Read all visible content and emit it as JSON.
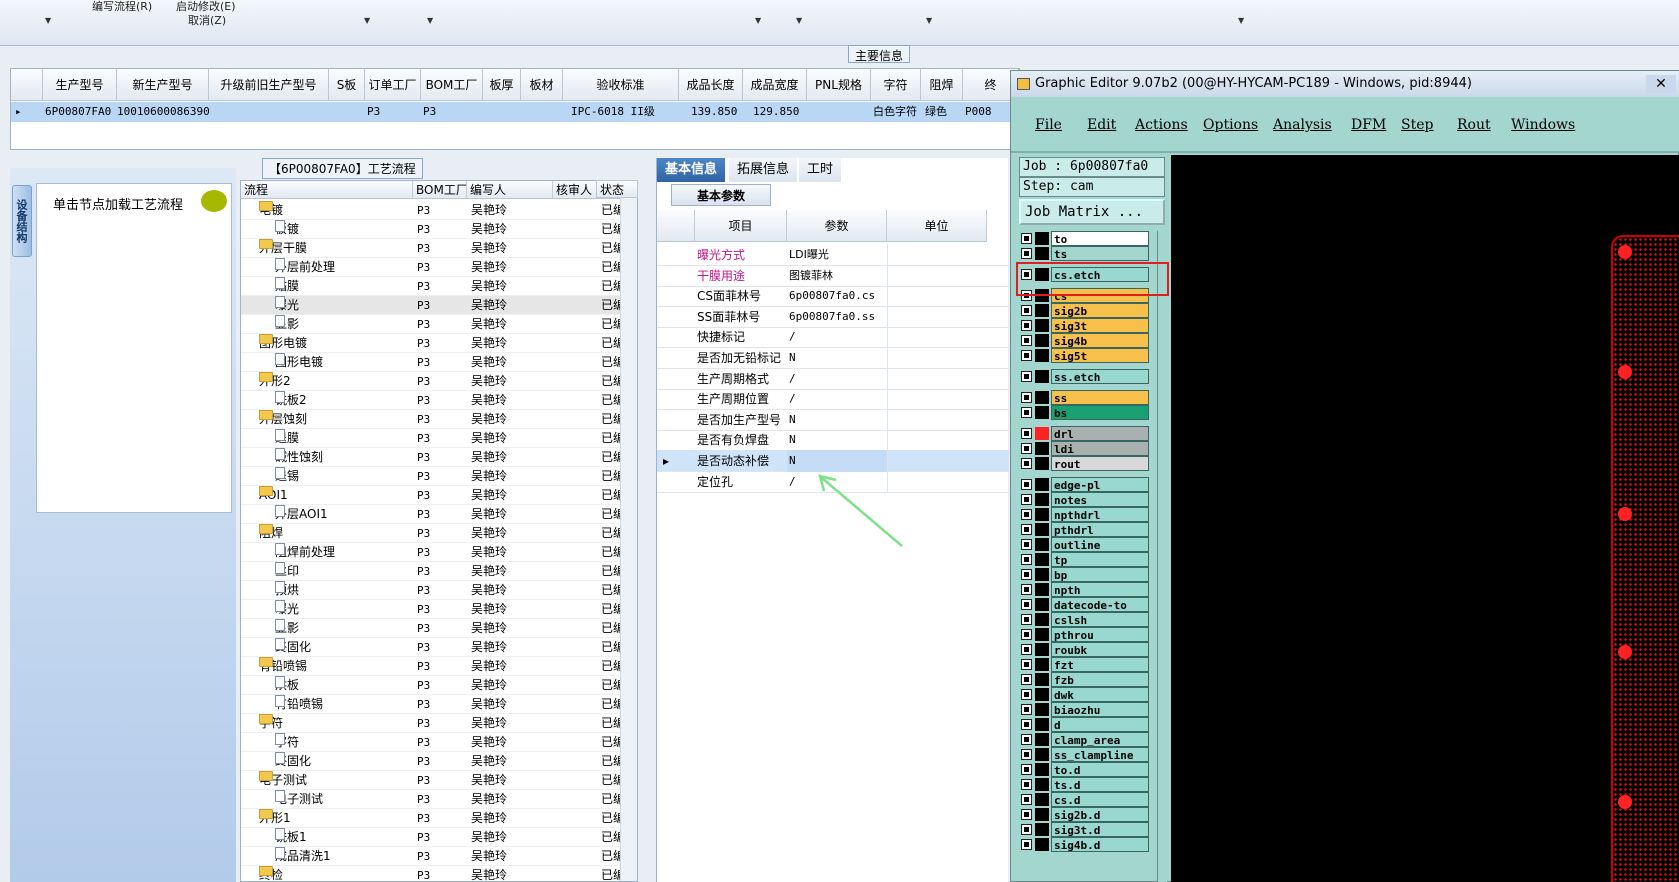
{
  "toolbar": {
    "item1": "编写流程(R)",
    "item2": "启动修改(E)",
    "item3": "取消(Z)"
  },
  "main_info_label": "主要信息",
  "product_table": {
    "columns": [
      "生产型号",
      "新生产型号",
      "升级前旧生产型号",
      "S板",
      "订单工厂",
      "BOM工厂",
      "板厚",
      "板材",
      "验收标准",
      "成品长度",
      "成品宽度",
      "PNL规格",
      "字符",
      "阻焊",
      "终"
    ],
    "row": [
      "6P00807FA0",
      "10010600086390",
      "",
      "",
      "P3",
      "P3",
      "",
      "",
      "IPC-6018 II级",
      "139.850",
      "129.850",
      "",
      "白色字符",
      "绿色",
      "P008"
    ]
  },
  "left_panel": {
    "tab_label": "设备结构",
    "hint": "单击节点加载工艺流程"
  },
  "process": {
    "title": "【6P00807FA0】工艺流程",
    "columns": [
      "流程",
      "BOM工厂",
      "编写人",
      "核审人",
      "状态"
    ],
    "rows": [
      {
        "name": "电镀",
        "type": "folder",
        "factory": "P3",
        "writer": "吴艳玲",
        "status": "已编写"
      },
      {
        "name": "板镀",
        "type": "doc",
        "factory": "P3",
        "writer": "吴艳玲",
        "status": "已编写"
      },
      {
        "name": "外层干膜",
        "type": "folder",
        "factory": "P3",
        "writer": "吴艳玲",
        "status": "已编写"
      },
      {
        "name": "外层前处理",
        "type": "doc",
        "factory": "P3",
        "writer": "吴艳玲",
        "status": "已编写"
      },
      {
        "name": "贴膜",
        "type": "doc",
        "factory": "P3",
        "writer": "吴艳玲",
        "status": "已编写"
      },
      {
        "name": "曝光",
        "type": "doc",
        "factory": "P3",
        "writer": "吴艳玲",
        "status": "已编写",
        "selected": true
      },
      {
        "name": "显影",
        "type": "doc",
        "factory": "P3",
        "writer": "吴艳玲",
        "status": "已编写"
      },
      {
        "name": "图形电镀",
        "type": "folder",
        "factory": "P3",
        "writer": "吴艳玲",
        "status": "已编写"
      },
      {
        "name": "图形电镀",
        "type": "doc",
        "factory": "P3",
        "writer": "吴艳玲",
        "status": "已编写"
      },
      {
        "name": "外形2",
        "type": "folder",
        "factory": "P3",
        "writer": "吴艳玲",
        "status": "已编写"
      },
      {
        "name": "铣板2",
        "type": "doc",
        "factory": "P3",
        "writer": "吴艳玲",
        "status": "已编写"
      },
      {
        "name": "外层蚀刻",
        "type": "folder",
        "factory": "P3",
        "writer": "吴艳玲",
        "status": "已编写"
      },
      {
        "name": "退膜",
        "type": "doc",
        "factory": "P3",
        "writer": "吴艳玲",
        "status": "已编写"
      },
      {
        "name": "碱性蚀刻",
        "type": "doc",
        "factory": "P3",
        "writer": "吴艳玲",
        "status": "已编写"
      },
      {
        "name": "退锡",
        "type": "doc",
        "factory": "P3",
        "writer": "吴艳玲",
        "status": "已编写"
      },
      {
        "name": "AOI1",
        "type": "folder",
        "factory": "P3",
        "writer": "吴艳玲",
        "status": "已编写"
      },
      {
        "name": "外层AOI1",
        "type": "doc",
        "factory": "P3",
        "writer": "吴艳玲",
        "status": "已编写"
      },
      {
        "name": "阻焊",
        "type": "folder",
        "factory": "P3",
        "writer": "吴艳玲",
        "status": "已编写"
      },
      {
        "name": "阻焊前处理",
        "type": "doc",
        "factory": "P3",
        "writer": "吴艳玲",
        "status": "已编写"
      },
      {
        "name": "丝印",
        "type": "doc",
        "factory": "P3",
        "writer": "吴艳玲",
        "status": "已编写"
      },
      {
        "name": "预烘",
        "type": "doc",
        "factory": "P3",
        "writer": "吴艳玲",
        "status": "已编写"
      },
      {
        "name": "曝光",
        "type": "doc",
        "factory": "P3",
        "writer": "吴艳玲",
        "status": "已编写"
      },
      {
        "name": "显影",
        "type": "doc",
        "factory": "P3",
        "writer": "吴艳玲",
        "status": "已编写"
      },
      {
        "name": "终固化",
        "type": "doc",
        "factory": "P3",
        "writer": "吴艳玲",
        "status": "已编写"
      },
      {
        "name": "有铅喷锡",
        "type": "folder",
        "factory": "P3",
        "writer": "吴艳玲",
        "status": "已编写"
      },
      {
        "name": "烘板",
        "type": "doc",
        "factory": "P3",
        "writer": "吴艳玲",
        "status": "已编写"
      },
      {
        "name": "有铅喷锡",
        "type": "doc",
        "factory": "P3",
        "writer": "吴艳玲",
        "status": "已编写"
      },
      {
        "name": "字符",
        "type": "folder",
        "factory": "P3",
        "writer": "吴艳玲",
        "status": "已编写"
      },
      {
        "name": "字符",
        "type": "doc",
        "factory": "P3",
        "writer": "吴艳玲",
        "status": "已编写"
      },
      {
        "name": "终固化",
        "type": "doc",
        "factory": "P3",
        "writer": "吴艳玲",
        "status": "已编写"
      },
      {
        "name": "电子测试",
        "type": "folder",
        "factory": "P3",
        "writer": "吴艳玲",
        "status": "已编写"
      },
      {
        "name": "电子测试",
        "type": "doc",
        "factory": "P3",
        "writer": "吴艳玲",
        "status": "已编写"
      },
      {
        "name": "外形1",
        "type": "folder",
        "factory": "P3",
        "writer": "吴艳玲",
        "status": "已编写"
      },
      {
        "name": "铣板1",
        "type": "doc",
        "factory": "P3",
        "writer": "吴艳玲",
        "status": "已编写"
      },
      {
        "name": "成品清洗1",
        "type": "doc",
        "factory": "P3",
        "writer": "吴艳玲",
        "status": "已编写"
      },
      {
        "name": "终检",
        "type": "folder",
        "factory": "P3",
        "writer": "吴艳玲",
        "status": "已编写"
      }
    ]
  },
  "params": {
    "tabs": [
      "基本信息",
      "拓展信息",
      "工时"
    ],
    "sub_tab": "基本参数",
    "columns": [
      "项目",
      "参数",
      "单位"
    ],
    "rows": [
      {
        "item": "曝光方式",
        "value": "LDI曝光",
        "highlight": true
      },
      {
        "item": "干膜用途",
        "value": "图镀菲林",
        "highlight": true
      },
      {
        "item": "CS面菲林号",
        "value": "6p00807fa0.cs"
      },
      {
        "item": "SS面菲林号",
        "value": "6p00807fa0.ss"
      },
      {
        "item": "快捷标记",
        "value": "/"
      },
      {
        "item": "是否加无铅标记",
        "value": "N"
      },
      {
        "item": "生产周期格式",
        "value": "/"
      },
      {
        "item": "生产周期位置",
        "value": "/"
      },
      {
        "item": "是否加生产型号",
        "value": "N"
      },
      {
        "item": "是否有负焊盘",
        "value": "N"
      },
      {
        "item": "是否动态补偿",
        "value": "N",
        "selected": true
      },
      {
        "item": "定位孔",
        "value": "/"
      }
    ]
  },
  "graphic_editor": {
    "title": "Graphic Editor 9.07b2 (00@HY-HYCAM-PC189 - Windows, pid:8944)",
    "menu": [
      "File",
      "Edit",
      "Actions",
      "Options",
      "Analysis",
      "DFM",
      "Step",
      "Rout",
      "Windows"
    ],
    "job": "Job : 6p00807fa0",
    "step": "Step: cam",
    "job_matrix": "Job Matrix ...",
    "layers": [
      {
        "name": "to",
        "color": "#ffffff"
      },
      {
        "name": "ts",
        "color": "#a3d6cf"
      },
      {
        "name": "cs.etch",
        "color": "#98d8d0"
      },
      {
        "name": "cs",
        "color": "#f7c04a"
      },
      {
        "name": "sig2b",
        "color": "#f7c04a"
      },
      {
        "name": "sig3t",
        "color": "#f7c04a"
      },
      {
        "name": "sig4b",
        "color": "#f7c04a"
      },
      {
        "name": "sig5t",
        "color": "#f7c04a"
      },
      {
        "name": "ss.etch",
        "color": "#98d8d0"
      },
      {
        "name": "ss",
        "color": "#f7c04a"
      },
      {
        "name": "bs",
        "color": "#1aa070"
      },
      {
        "name": "drl",
        "color": "#a8b0b0"
      },
      {
        "name": "ldi",
        "color": "#a8b0b0"
      },
      {
        "name": "rout",
        "color": "#d8d8d8"
      },
      {
        "name": "edge-pl",
        "color": "#98d8d0"
      },
      {
        "name": "notes",
        "color": "#98d8d0"
      },
      {
        "name": "npthdrl",
        "color": "#98d8d0"
      },
      {
        "name": "pthdrl",
        "color": "#98d8d0"
      },
      {
        "name": "outline",
        "color": "#98d8d0"
      },
      {
        "name": "tp",
        "color": "#98d8d0"
      },
      {
        "name": "bp",
        "color": "#98d8d0"
      },
      {
        "name": "npth",
        "color": "#98d8d0"
      },
      {
        "name": "datecode-to",
        "color": "#98d8d0"
      },
      {
        "name": "cslsh",
        "color": "#98d8d0"
      },
      {
        "name": "pthrou",
        "color": "#98d8d0"
      },
      {
        "name": "roubk",
        "color": "#98d8d0"
      },
      {
        "name": "fzt",
        "color": "#98d8d0"
      },
      {
        "name": "fzb",
        "color": "#98d8d0"
      },
      {
        "name": "dwk",
        "color": "#98d8d0"
      },
      {
        "name": "biaozhu",
        "color": "#98d8d0"
      },
      {
        "name": "d",
        "color": "#98d8d0"
      },
      {
        "name": "clamp_area",
        "color": "#98d8d0"
      },
      {
        "name": "ss_clampline",
        "color": "#98d8d0"
      },
      {
        "name": "to.d",
        "color": "#98d8d0"
      },
      {
        "name": "ts.d",
        "color": "#98d8d0"
      },
      {
        "name": "cs.d",
        "color": "#98d8d0"
      },
      {
        "name": "sig2b.d",
        "color": "#98d8d0"
      },
      {
        "name": "sig3t.d",
        "color": "#98d8d0"
      },
      {
        "name": "sig4b.d",
        "color": "#98d8d0"
      }
    ]
  }
}
